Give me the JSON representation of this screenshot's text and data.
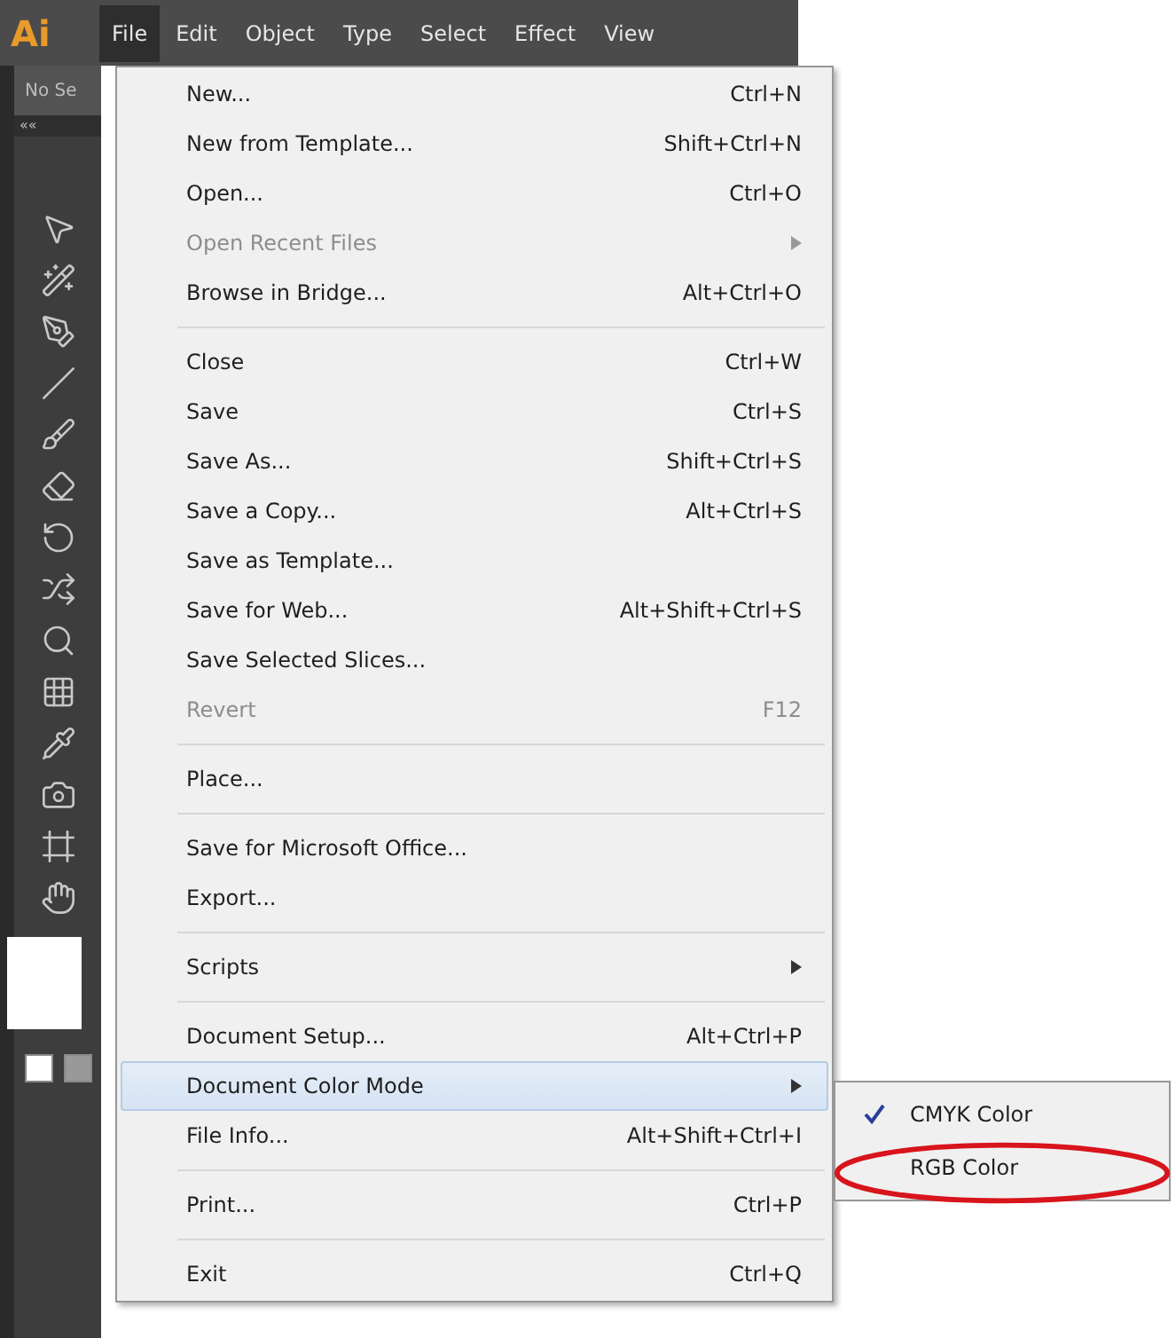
{
  "app": {
    "logo": "Ai"
  },
  "menubar": [
    {
      "label": "File",
      "selected": true
    },
    {
      "label": "Edit",
      "selected": false
    },
    {
      "label": "Object",
      "selected": false
    },
    {
      "label": "Type",
      "selected": false
    },
    {
      "label": "Select",
      "selected": false
    },
    {
      "label": "Effect",
      "selected": false
    },
    {
      "label": "View",
      "selected": false
    }
  ],
  "control_bar": {
    "label": "No Se",
    "collapse": "««"
  },
  "file_menu": [
    {
      "kind": "item",
      "label": "New...",
      "shortcut": "Ctrl+N",
      "disabled": false,
      "submenu": false,
      "highlighted": false
    },
    {
      "kind": "item",
      "label": "New from Template...",
      "shortcut": "Shift+Ctrl+N",
      "disabled": false,
      "submenu": false,
      "highlighted": false
    },
    {
      "kind": "item",
      "label": "Open...",
      "shortcut": "Ctrl+O",
      "disabled": false,
      "submenu": false,
      "highlighted": false
    },
    {
      "kind": "item",
      "label": "Open Recent Files",
      "disabled": true,
      "submenu": true,
      "highlighted": false
    },
    {
      "kind": "item",
      "label": "Browse in Bridge...",
      "shortcut": "Alt+Ctrl+O",
      "disabled": false,
      "submenu": false,
      "highlighted": false
    },
    {
      "kind": "separator"
    },
    {
      "kind": "item",
      "label": "Close",
      "shortcut": "Ctrl+W",
      "disabled": false,
      "submenu": false,
      "highlighted": false
    },
    {
      "kind": "item",
      "label": "Save",
      "shortcut": "Ctrl+S",
      "disabled": false,
      "submenu": false,
      "highlighted": false
    },
    {
      "kind": "item",
      "label": "Save As...",
      "shortcut": "Shift+Ctrl+S",
      "disabled": false,
      "submenu": false,
      "highlighted": false
    },
    {
      "kind": "item",
      "label": "Save a Copy...",
      "shortcut": "Alt+Ctrl+S",
      "disabled": false,
      "submenu": false,
      "highlighted": false
    },
    {
      "kind": "item",
      "label": "Save as Template...",
      "disabled": false,
      "submenu": false,
      "highlighted": false
    },
    {
      "kind": "item",
      "label": "Save for Web...",
      "shortcut": "Alt+Shift+Ctrl+S",
      "disabled": false,
      "submenu": false,
      "highlighted": false
    },
    {
      "kind": "item",
      "label": "Save Selected Slices...",
      "disabled": false,
      "submenu": false,
      "highlighted": false
    },
    {
      "kind": "item",
      "label": "Revert",
      "shortcut": "F12",
      "disabled": true,
      "submenu": false,
      "highlighted": false
    },
    {
      "kind": "separator"
    },
    {
      "kind": "item",
      "label": "Place...",
      "disabled": false,
      "submenu": false,
      "highlighted": false
    },
    {
      "kind": "separator"
    },
    {
      "kind": "item",
      "label": "Save for Microsoft Office...",
      "disabled": false,
      "submenu": false,
      "highlighted": false
    },
    {
      "kind": "item",
      "label": "Export...",
      "disabled": false,
      "submenu": false,
      "highlighted": false
    },
    {
      "kind": "separator"
    },
    {
      "kind": "item",
      "label": "Scripts",
      "disabled": false,
      "submenu": true,
      "highlighted": false
    },
    {
      "kind": "separator"
    },
    {
      "kind": "item",
      "label": "Document Setup...",
      "shortcut": "Alt+Ctrl+P",
      "disabled": false,
      "submenu": false,
      "highlighted": false
    },
    {
      "kind": "item",
      "label": "Document Color Mode",
      "disabled": false,
      "submenu": true,
      "highlighted": true
    },
    {
      "kind": "item",
      "label": "File Info...",
      "shortcut": "Alt+Shift+Ctrl+I",
      "disabled": false,
      "submenu": false,
      "highlighted": false
    },
    {
      "kind": "separator"
    },
    {
      "kind": "item",
      "label": "Print...",
      "shortcut": "Ctrl+P",
      "disabled": false,
      "submenu": false,
      "highlighted": false
    },
    {
      "kind": "separator"
    },
    {
      "kind": "item",
      "label": "Exit",
      "shortcut": "Ctrl+Q",
      "disabled": false,
      "submenu": false,
      "highlighted": false
    }
  ],
  "color_mode_submenu": [
    {
      "label": "CMYK Color",
      "checked": true,
      "circled": false
    },
    {
      "label": "RGB Color",
      "checked": false,
      "circled": true
    }
  ]
}
